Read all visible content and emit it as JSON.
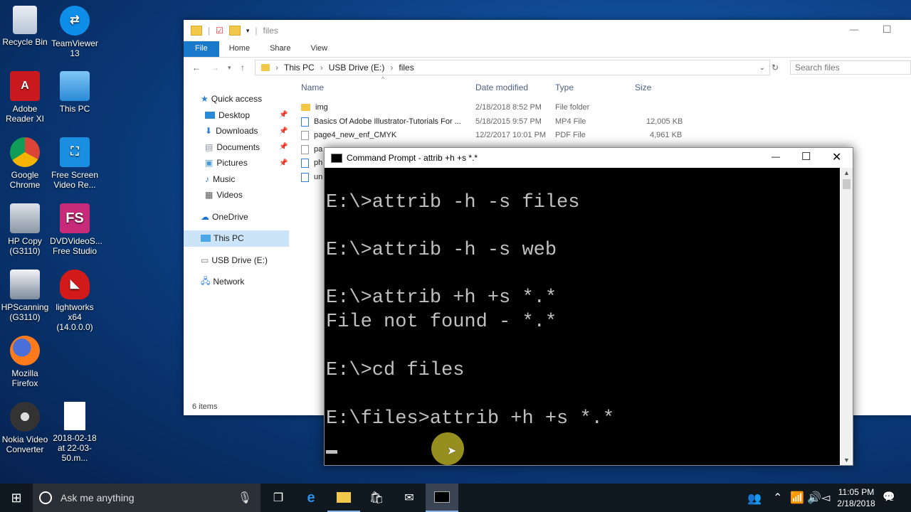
{
  "desktop_icons": [
    {
      "label": "Recycle Bin",
      "icon": "recycle-bin-icon"
    },
    {
      "label": "TeamViewer 13",
      "icon": "teamviewer-icon"
    },
    {
      "label": "Adobe Reader XI",
      "icon": "adobe-reader-icon"
    },
    {
      "label": "This PC",
      "icon": "this-pc-icon"
    },
    {
      "label": "Google Chrome",
      "icon": "chrome-icon"
    },
    {
      "label": "Free Screen Video Re...",
      "icon": "screen-recorder-icon"
    },
    {
      "label": "HP Copy (G3110)",
      "icon": "hp-copy-icon"
    },
    {
      "label": "DVDVideoS... Free Studio",
      "icon": "dvdvideosoft-icon"
    },
    {
      "label": "HPScanning (G3110)",
      "icon": "hp-scanning-icon"
    },
    {
      "label": "lightworks x64 (14.0.0.0)",
      "icon": "lightworks-icon"
    },
    {
      "label": "Mozilla Firefox",
      "icon": "firefox-icon"
    },
    {
      "label": "2018-02-18 at 22-03-50.m...",
      "icon": "file-icon"
    },
    {
      "label": "Nokia Video Converter",
      "icon": "nokia-video-icon"
    }
  ],
  "explorer": {
    "title": "files",
    "ribbon_tabs": [
      "File",
      "Home",
      "Share",
      "View"
    ],
    "breadcrumb": [
      "This PC",
      "USB Drive (E:)",
      "files"
    ],
    "search_placeholder": "Search files",
    "sidebar": [
      {
        "label": "Quick access"
      },
      {
        "label": "Desktop"
      },
      {
        "label": "Downloads"
      },
      {
        "label": "Documents"
      },
      {
        "label": "Pictures"
      },
      {
        "label": "Music"
      },
      {
        "label": "Videos"
      },
      {
        "label": "OneDrive"
      },
      {
        "label": "This PC"
      },
      {
        "label": "USB Drive (E:)"
      },
      {
        "label": "Network"
      }
    ],
    "columns": [
      "Name",
      "Date modified",
      "Type",
      "Size"
    ],
    "files": [
      {
        "name": "img",
        "date": "2/18/2018 8:52 PM",
        "type": "File folder",
        "size": ""
      },
      {
        "name": "Basics Of Adobe Illustrator-Tutorials For ...",
        "date": "5/18/2015 9:57 PM",
        "type": "MP4 File",
        "size": "12,005 KB"
      },
      {
        "name": "page4_new_enf_CMYK",
        "date": "12/2/2017 10:01 PM",
        "type": "PDF File",
        "size": "4,961 KB"
      },
      {
        "name": "pa",
        "date": "",
        "type": "",
        "size": ""
      },
      {
        "name": "ph",
        "date": "",
        "type": "",
        "size": ""
      },
      {
        "name": "un",
        "date": "",
        "type": "",
        "size": ""
      }
    ],
    "status": "6 items"
  },
  "cmd": {
    "title": "Command Prompt - attrib  +h +s *.*",
    "lines": [
      "E:\\>attrib -h -s files",
      "E:\\>attrib -h -s web",
      "E:\\>attrib +h +s *.*",
      "File not found - *.*",
      "E:\\>cd files",
      "E:\\files>attrib +h +s *.*"
    ]
  },
  "taskbar": {
    "search_placeholder": "Ask me anything",
    "time": "11:05 PM",
    "date": "2/18/2018",
    "notification_count": "2"
  }
}
